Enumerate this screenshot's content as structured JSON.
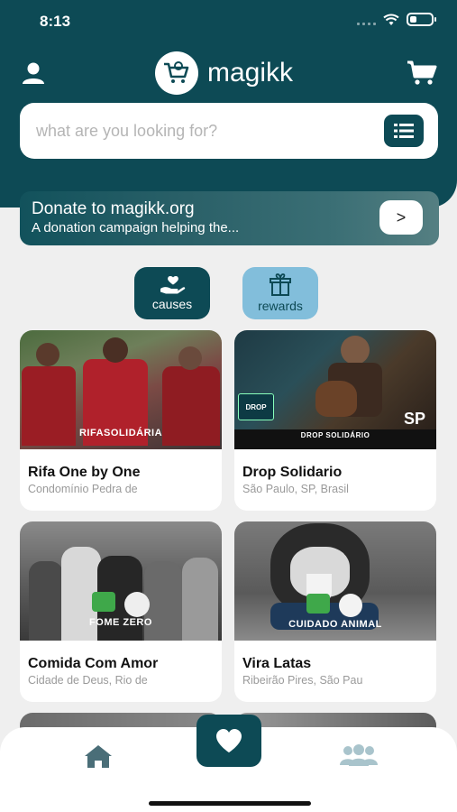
{
  "status_bar": {
    "time": "8:13",
    "battery_level": 0.3
  },
  "header": {
    "logo_text": "magikk",
    "search": {
      "placeholder": "what are you looking for?",
      "value": ""
    }
  },
  "donate_banner": {
    "title": "Donate to magikk.org",
    "subtitle": "A donation campaign helping the...",
    "arrow": ">"
  },
  "filters": [
    {
      "label": "causes",
      "icon": "hand-heart-icon"
    },
    {
      "label": "rewards",
      "icon": "gift-box-icon"
    }
  ],
  "cards": [
    {
      "title": "Rifa One by One",
      "location": "Condomínio Pedra de",
      "image_tag": "RIFASOLIDÁRIA"
    },
    {
      "title": "Drop Solidario",
      "location": "São Paulo, SP, Brasil",
      "image_tag": "DROP SOLIDÁRIO",
      "image_badge": "SP"
    },
    {
      "title": "Comida Com Amor",
      "location": "Cidade de Deus, Rio de",
      "image_tag": "FOME ZERO"
    },
    {
      "title": "Vira Latas",
      "location": "Ribeirão Pires, São Pau",
      "image_tag": "CUIDADO ANIMAL"
    }
  ],
  "bottom_nav": [
    {
      "name": "home",
      "icon": "home-icon"
    },
    {
      "name": "favorites",
      "icon": "heart-icon"
    },
    {
      "name": "community",
      "icon": "users-icon"
    }
  ],
  "colors": {
    "primary": "#0d4a55",
    "accent": "#82bedb",
    "background": "#efefef"
  }
}
